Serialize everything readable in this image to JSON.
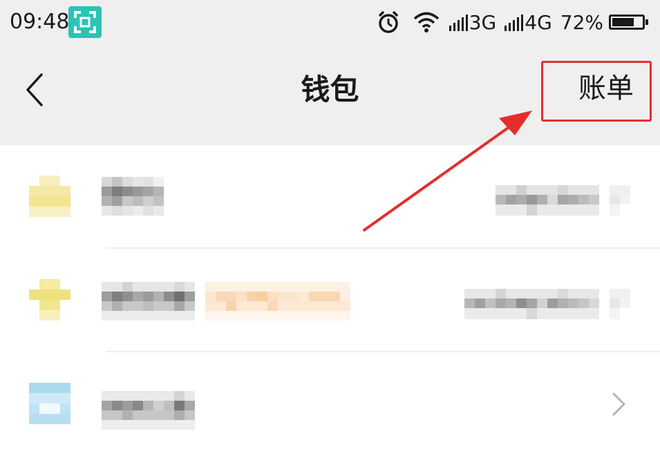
{
  "status_bar": {
    "time": "09:48",
    "network_1": "3G",
    "network_2": "4G",
    "battery_percent": "72%",
    "icons": [
      "scan-icon",
      "alarm-icon",
      "wifi-icon",
      "signal-icon",
      "battery-icon"
    ]
  },
  "navbar": {
    "title": "钱包",
    "right_button": "账单",
    "back_icon": "chevron-left-icon"
  },
  "annotation": {
    "highlight_color": "#e52d2d"
  },
  "list": {
    "rows": [
      {
        "icon_color": "#f6e9a6",
        "pixelated": true
      },
      {
        "icon_color": "#f4eca0",
        "pixelated": true
      },
      {
        "icon_color": "#bfe3f3",
        "pixelated": true,
        "has_chevron": true
      }
    ]
  },
  "colors": {
    "bar_background": "#efefef",
    "list_background": "#ffffff",
    "teal": "#2cc3b6"
  }
}
